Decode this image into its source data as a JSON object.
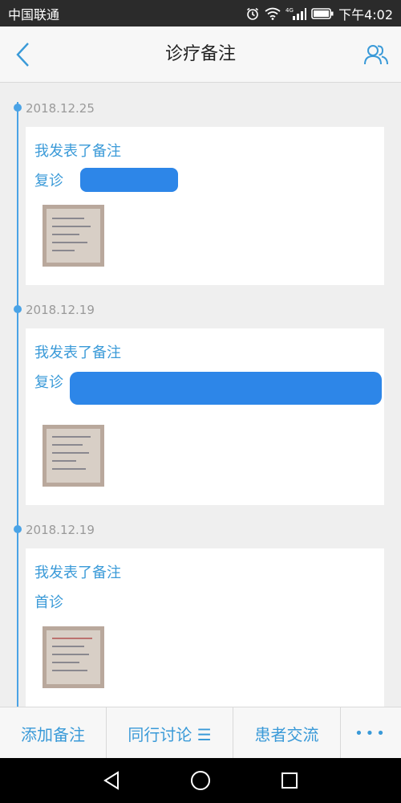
{
  "status_bar": {
    "carrier": "中国联通",
    "network": "4G",
    "time": "下午4:02"
  },
  "header": {
    "title": "诊疗备注",
    "back_icon": "chevron-left-icon",
    "right_icon": "users-icon"
  },
  "timeline": [
    {
      "date": "2018.12.25",
      "author": "我发表了备注",
      "type": "复诊"
    },
    {
      "date": "2018.12.19",
      "author": "我发表了备注",
      "type": "复诊"
    },
    {
      "date": "2018.12.19",
      "author": "我发表了备注",
      "type": "首诊"
    }
  ],
  "toolbar": {
    "add_note": "添加备注",
    "peer_discussion": "同行讨论 ☰",
    "patient_chat": "患者交流",
    "more": "•••"
  },
  "nav": {
    "back_icon": "triangle-back-icon",
    "home_icon": "circle-home-icon",
    "recents_icon": "square-recents-icon"
  },
  "colors": {
    "accent": "#3a9ad8",
    "timeline": "#4aa3e6",
    "redaction": "#2d86e8",
    "status_bar": "#2b2b2b",
    "background": "#efefef"
  }
}
